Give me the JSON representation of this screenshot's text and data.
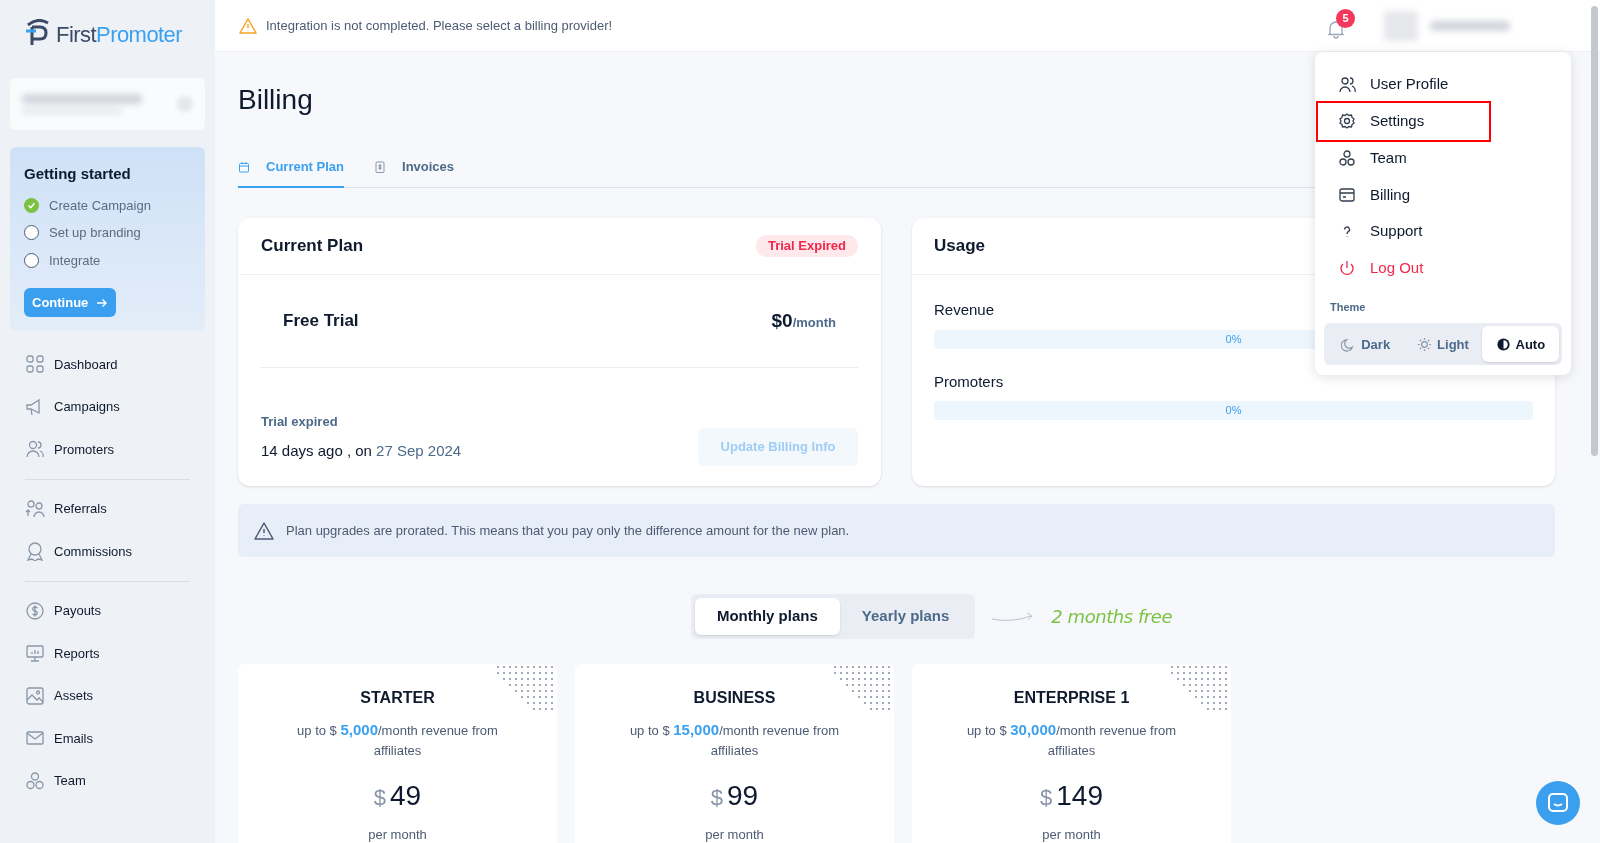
{
  "logo": {
    "first": "First",
    "second": "Promoter"
  },
  "getting_started": {
    "title": "Getting started",
    "steps": [
      {
        "label": "Create Campaign",
        "checked": true
      },
      {
        "label": "Set up branding",
        "checked": false
      },
      {
        "label": "Integrate",
        "checked": false
      }
    ],
    "button": "Continue"
  },
  "sidebar": {
    "groups": [
      [
        {
          "label": "Dashboard"
        },
        {
          "label": "Campaigns"
        },
        {
          "label": "Promoters"
        }
      ],
      [
        {
          "label": "Referrals"
        },
        {
          "label": "Commissions"
        }
      ],
      [
        {
          "label": "Payouts"
        },
        {
          "label": "Reports"
        },
        {
          "label": "Assets"
        },
        {
          "label": "Emails"
        },
        {
          "label": "Team"
        }
      ]
    ]
  },
  "alert": "Integration is not completed. Please select a billing provider!",
  "notifications": {
    "count": "5"
  },
  "page_title": "Billing",
  "tabs": [
    {
      "label": "Current Plan",
      "selected": true
    },
    {
      "label": "Invoices",
      "selected": false
    }
  ],
  "current_plan": {
    "title": "Current Plan",
    "badge": "Trial Expired",
    "plan": "Free Trial",
    "price": "$0",
    "period": "/month",
    "expired_label": "Trial expired",
    "expired_text": "14 days ago , on",
    "expired_date": "27 Sep 2024",
    "button": "Update Billing Info"
  },
  "usage": {
    "title": "Usage",
    "meters": [
      {
        "name": "Revenue",
        "level": 0,
        "reading": "0%"
      },
      {
        "name": "Promoters",
        "level": 0,
        "reading": "0%"
      }
    ]
  },
  "notice": "Plan upgrades are prorated. This means that you pay only the difference amount for the new plan.",
  "billing_toggle": [
    {
      "label": "Monthly plans",
      "selected": true
    },
    {
      "label": "Yearly plans",
      "selected": false
    }
  ],
  "promo": "2 months free",
  "plans": [
    {
      "name": "STARTER",
      "limit": "up to $ **5,000**/month revenue from affiliates",
      "currency": "$",
      "price": "49",
      "period": "per month"
    },
    {
      "name": "BUSINESS",
      "limit": "up to $ **15,000**/month revenue from affiliates",
      "currency": "$",
      "price": "99",
      "period": "per month"
    },
    {
      "name": "ENTERPRISE 1",
      "limit": "up to $ **30,000**/month revenue from affiliates",
      "currency": "$",
      "price": "149",
      "period": "per month"
    }
  ],
  "user_menu": {
    "items": [
      {
        "label": "User Profile",
        "kind": "normal",
        "highlighted": false
      },
      {
        "label": "Settings",
        "kind": "normal",
        "highlighted": true
      },
      {
        "label": "Team",
        "kind": "normal",
        "highlighted": false
      },
      {
        "label": "Billing",
        "kind": "normal",
        "highlighted": false
      },
      {
        "label": "Support",
        "kind": "normal",
        "highlighted": false
      },
      {
        "label": "Log Out",
        "kind": "danger",
        "highlighted": false
      }
    ],
    "theme_label": "Theme",
    "themes": [
      {
        "label": "Dark",
        "selected": false
      },
      {
        "label": "Light",
        "selected": false
      },
      {
        "label": "Auto",
        "selected": true
      }
    ]
  }
}
